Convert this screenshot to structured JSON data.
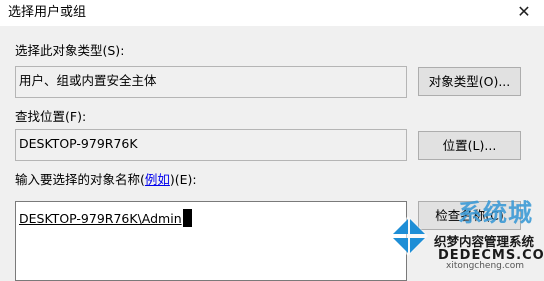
{
  "window": {
    "title": "选择用户或组",
    "close_glyph": "✕"
  },
  "object_types": {
    "label": "选择此对象类型(S):",
    "value": "用户、组或内置安全主体",
    "button": "对象类型(O)..."
  },
  "location": {
    "label": "查找位置(F):",
    "value": "DESKTOP-979R76K",
    "button": "位置(L)..."
  },
  "names": {
    "label_prefix": "输入要选择的对象名称(",
    "label_link": "例如",
    "label_suffix": ")(E):",
    "value": "DESKTOP-979R76K\\Admin",
    "check_button": "检查名称(C)"
  },
  "watermark": {
    "site": "系统城",
    "name": "织梦内容管理系统",
    "domain": "DEDECMS.COM",
    "url": "xitongcheng.com",
    "colors": {
      "logo": "#1e8ed6",
      "text": "#3d9bd6"
    }
  }
}
